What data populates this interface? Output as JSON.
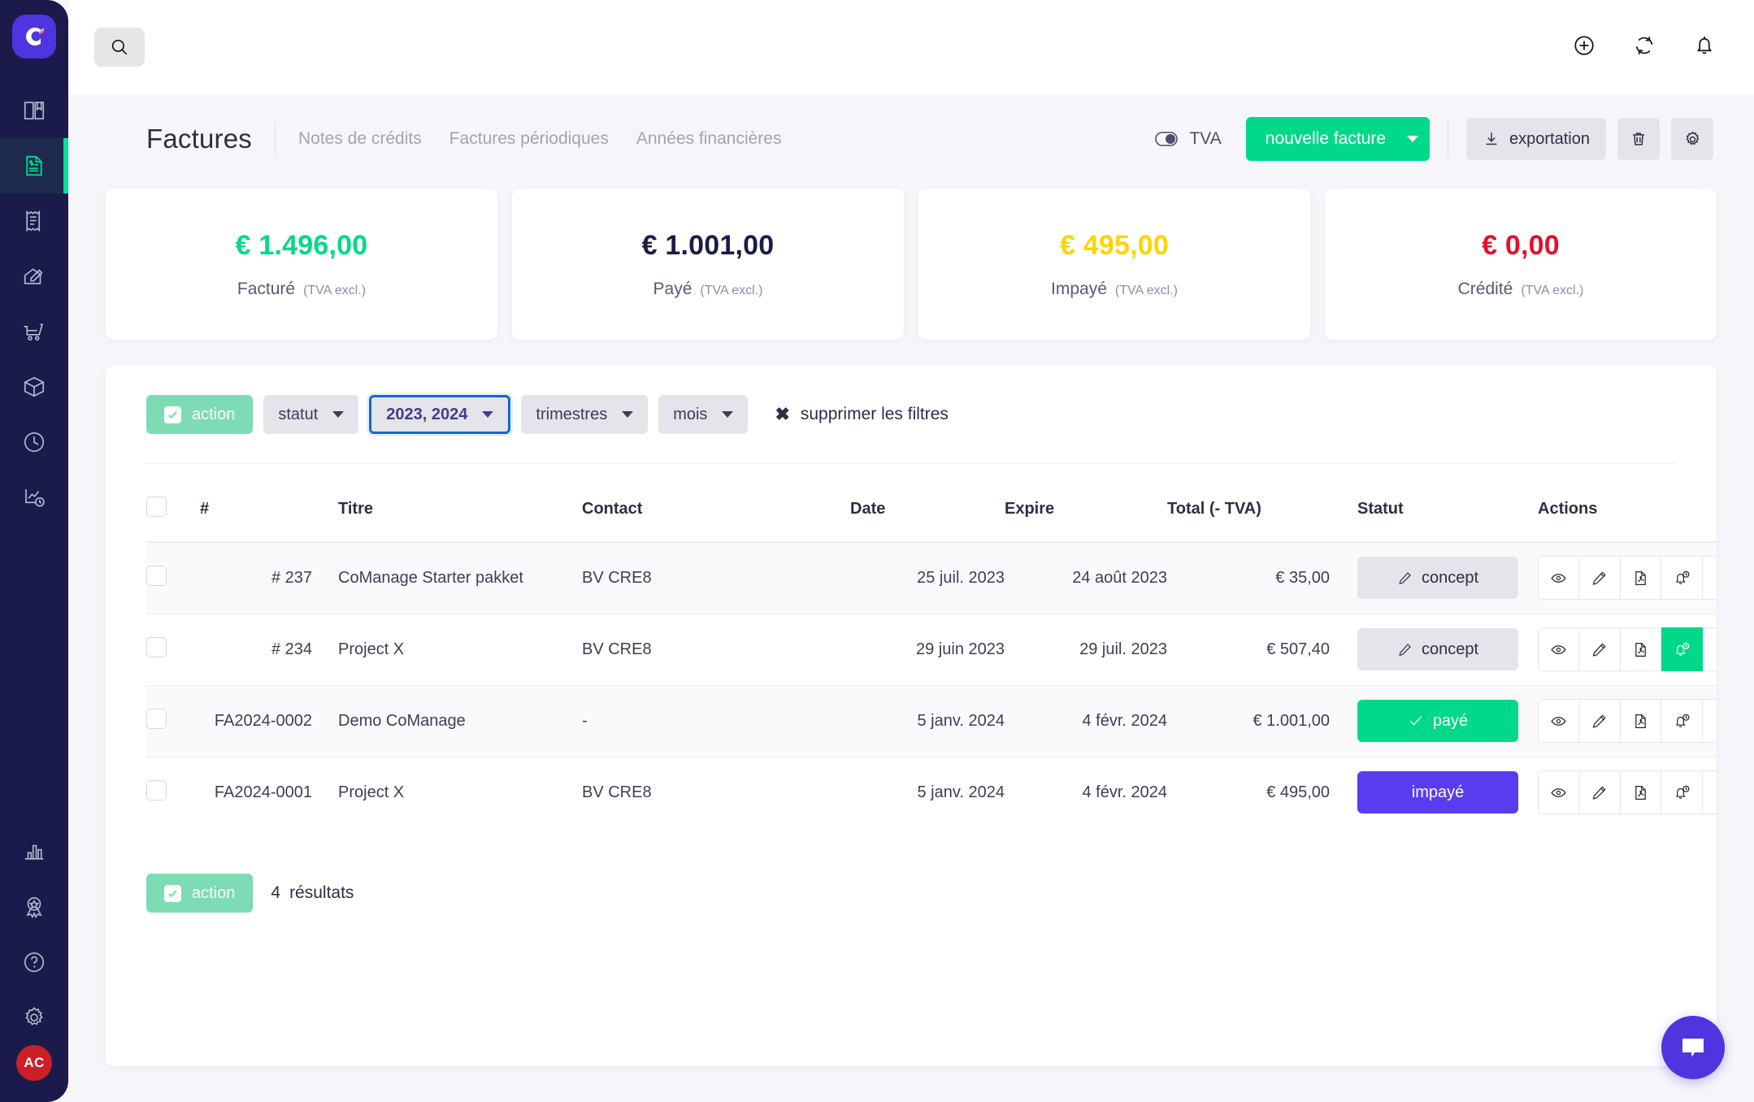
{
  "brand": {
    "logo_letter": "C",
    "accent_green": "#00d98a",
    "accent_purple": "#4f35e0",
    "sidebar_bg": "#1b1b4b"
  },
  "sidebar": {
    "items": [
      {
        "name": "book-icon",
        "label": ""
      },
      {
        "name": "invoice-icon",
        "label": ""
      },
      {
        "name": "receipt-icon",
        "label": ""
      },
      {
        "name": "signature-icon",
        "label": ""
      },
      {
        "name": "cart-icon",
        "label": ""
      },
      {
        "name": "box-icon",
        "label": ""
      },
      {
        "name": "clock-icon",
        "label": ""
      },
      {
        "name": "report-clock-icon",
        "label": ""
      },
      {
        "name": "chart-bar-icon",
        "label": ""
      },
      {
        "name": "award-icon",
        "label": ""
      },
      {
        "name": "help-circle-icon",
        "label": ""
      },
      {
        "name": "gear-icon",
        "label": ""
      }
    ],
    "avatar_initials": "AC"
  },
  "topbar": {
    "search_placeholder": "",
    "icons": [
      "plus-circle-icon",
      "refresh-icon",
      "bell-icon"
    ]
  },
  "header": {
    "title": "Factures",
    "tabs": [
      {
        "label": "Notes de crédits"
      },
      {
        "label": "Factures périodiques"
      },
      {
        "label": "Années financières"
      }
    ],
    "tva_toggle_label": "TVA",
    "new_invoice_label": "nouvelle facture",
    "export_label": "exportation",
    "delete_icon": "trash-icon",
    "settings_icon": "gear-icon"
  },
  "stats": [
    {
      "value": "€ 1.496,00",
      "label": "Facturé",
      "sub": "(TVA excl.)",
      "color": "#00d98a"
    },
    {
      "value": "€ 1.001,00",
      "label": "Payé",
      "sub": "(TVA excl.)",
      "color": "#1b1b4b"
    },
    {
      "value": "€ 495,00",
      "label": "Impayé",
      "sub": "(TVA excl.)",
      "color": "#ffd400"
    },
    {
      "value": "€ 0,00",
      "label": "Crédité",
      "sub": "(TVA excl.)",
      "color": "#e4102a"
    }
  ],
  "filters": {
    "action_label": "action",
    "statut_label": "statut",
    "years_label": "2023, 2024",
    "trimestres_label": "trimestres",
    "mois_label": "mois",
    "clear_label": "supprimer les filtres"
  },
  "table": {
    "columns": [
      "",
      "#",
      "Titre",
      "Contact",
      "Date",
      "Expire",
      "Total (- TVA)",
      "Statut",
      "Actions"
    ],
    "rows": [
      {
        "number": "# 237",
        "title": "CoManage Starter pakket",
        "contact": "BV CRE8",
        "date": "25 juil. 2023",
        "expire": "24 août 2023",
        "total": "€ 35,00",
        "status": "concept",
        "status_kind": "concept",
        "reminder_active": false
      },
      {
        "number": "# 234",
        "title": "Project X",
        "contact": "BV CRE8",
        "date": "29 juin 2023",
        "expire": "29 juil. 2023",
        "total": "€ 507,40",
        "status": "concept",
        "status_kind": "concept",
        "reminder_active": true
      },
      {
        "number": "FA2024-0002",
        "title": "Demo CoManage",
        "contact": "-",
        "date": "5 janv. 2024",
        "expire": "4 févr. 2024",
        "total": "€ 1.001,00",
        "status": "payé",
        "status_kind": "paye",
        "reminder_active": false
      },
      {
        "number": "FA2024-0001",
        "title": "Project X",
        "contact": "BV CRE8",
        "date": "5 janv. 2024",
        "expire": "4 févr. 2024",
        "total": "€ 495,00",
        "status": "impayé",
        "status_kind": "impaye",
        "reminder_active": false
      }
    ],
    "action_icons": [
      "eye-icon",
      "pencil-icon",
      "pdf-icon",
      "reminder-bell-icon",
      "chevron-double-down-icon"
    ]
  },
  "footer": {
    "action_label": "action",
    "results_count": "4",
    "results_label": "résultats"
  },
  "chat": {
    "icon": "chat-bubble-icon"
  }
}
